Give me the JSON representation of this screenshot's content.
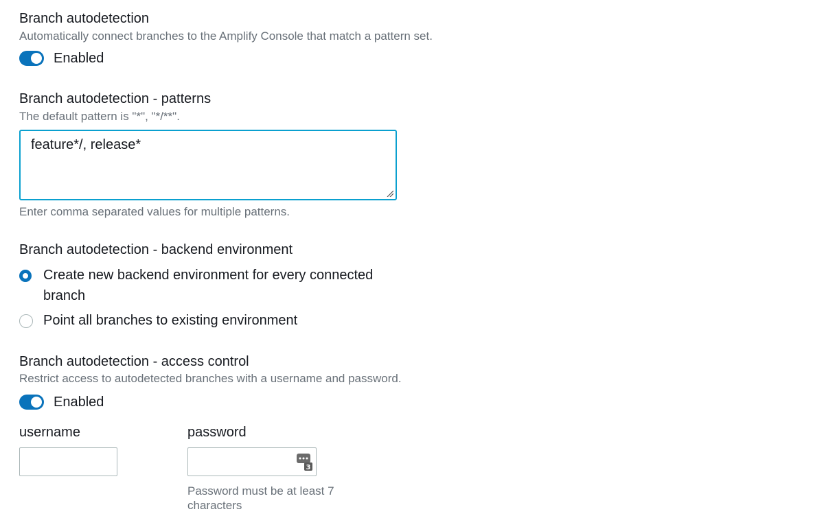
{
  "autodetection": {
    "label": "Branch autodetection",
    "description": "Automatically connect branches to the Amplify Console that match a pattern set.",
    "toggle_label": "Enabled",
    "enabled": true
  },
  "patterns": {
    "label": "Branch autodetection - patterns",
    "description": "The default pattern is \"*\", \"*/**\".",
    "value": "feature*/, release*",
    "hint": "Enter comma separated values for multiple patterns."
  },
  "backend": {
    "label": "Branch autodetection - backend environment",
    "options": [
      {
        "label": "Create new backend environment for every connected branch",
        "selected": true
      },
      {
        "label": "Point all branches to existing environment",
        "selected": false
      }
    ]
  },
  "access_control": {
    "label": "Branch autodetection - access control",
    "description": "Restrict access to autodetected branches with a username and password.",
    "toggle_label": "Enabled",
    "enabled": true,
    "username_label": "username",
    "username_value": "",
    "password_label": "password",
    "password_value": "",
    "password_hint": "Password must be at least 7 characters",
    "password_manager_badge": "3"
  },
  "colors": {
    "accent": "#0a73bb",
    "focus_border": "#0aa0cf",
    "muted_text": "#687078"
  }
}
